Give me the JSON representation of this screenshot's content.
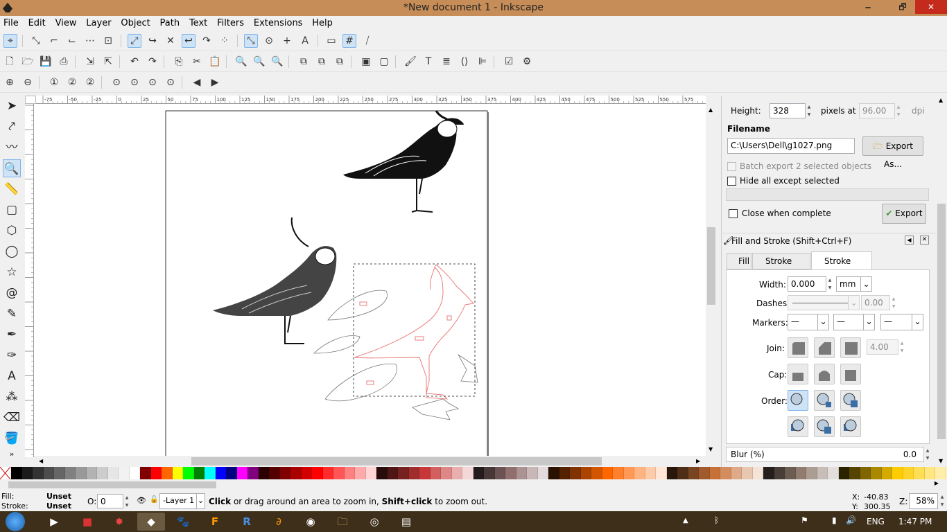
{
  "window": {
    "title": "*New document 1 - Inkscape",
    "minimize": "🗕",
    "restore": "🗗",
    "close": "✕"
  },
  "menu": [
    "File",
    "Edit",
    "View",
    "Layer",
    "Object",
    "Path",
    "Text",
    "Filters",
    "Extensions",
    "Help"
  ],
  "ruler": {
    "h_ticks": [
      "-75",
      "-50",
      "-25",
      "0",
      "25",
      "50",
      "75",
      "100",
      "125",
      "150",
      "175",
      "200",
      "225",
      "250",
      "275",
      "300",
      "325",
      "350",
      "375",
      "400",
      "425",
      "450",
      "475",
      "500",
      "525",
      "550",
      "575"
    ],
    "v_ticks": [
      "0",
      "2",
      "5",
      "0",
      "7",
      "5",
      "1",
      "0",
      "0",
      "1",
      "2",
      "5",
      "1",
      "5",
      "0",
      "1",
      "7",
      "5"
    ]
  },
  "export": {
    "height_label": "Height:",
    "height_value": "328",
    "pixels_at_label": "pixels at",
    "dpi_value": "96.00",
    "dpi_label": "dpi",
    "filename_heading": "Filename",
    "filename_value": "C:\\Users\\Dell\\g1027.png",
    "export_as_label": "Export As...",
    "batch_label": "Batch export 2 selected objects",
    "hide_label": "Hide all except selected",
    "close_label": "Close when complete",
    "export_label": "Export"
  },
  "fill_stroke": {
    "title": "Fill and Stroke (Shift+Ctrl+F)",
    "tabs": [
      "Fill",
      "Stroke paint",
      "Stroke style"
    ],
    "width_label": "Width:",
    "width_value": "0.000",
    "width_unit": "mm",
    "dashes_label": "Dashes:",
    "dashes_offset": "0.00",
    "markers_label": "Markers:",
    "marker_value": "—",
    "join_label": "Join:",
    "miter_value": "4.00",
    "cap_label": "Cap:",
    "order_label": "Order:",
    "blur_label": "Blur (%)",
    "blur_value": "0.0"
  },
  "palette_colors": [
    "#000000",
    "#1a1a1a",
    "#333333",
    "#4d4d4d",
    "#666666",
    "#808080",
    "#999999",
    "#b3b3b3",
    "#cccccc",
    "#e6e6e6",
    "#f2f2f2",
    "#ffffff",
    "#800000",
    "#ff0000",
    "#ff6600",
    "#ffff00",
    "#00ff00",
    "#008000",
    "#00ffff",
    "#0000ff",
    "#000080",
    "#ff00ff",
    "#800080",
    "#2b0000",
    "#550000",
    "#800000",
    "#aa0000",
    "#d40000",
    "#ff0000",
    "#ff2a2a",
    "#ff5555",
    "#ff8080",
    "#ffaaaa",
    "#ffd5d5",
    "#280b0b",
    "#501616",
    "#782121",
    "#a02c2c",
    "#c83737",
    "#d35f5f",
    "#de8787",
    "#e9afaf",
    "#f4d7d7",
    "#241c1c",
    "#483737",
    "#6c5353",
    "#916f6f",
    "#ac9393",
    "#c8b7b7",
    "#e3dbdb",
    "#2b1100",
    "#552200",
    "#803300",
    "#aa4400",
    "#d45500",
    "#ff6600",
    "#ff7f2a",
    "#ff9955",
    "#ffb380",
    "#ffccaa",
    "#ffe6d5",
    "#28170b",
    "#502d16",
    "#784421",
    "#a05a2c",
    "#c87137",
    "#d38d5f",
    "#deaa87",
    "#e9c6af",
    "#f4e3d7",
    "#241f1c",
    "#483e37",
    "#6c5d53",
    "#917c6f",
    "#ac9d93",
    "#c8beb7",
    "#e3dedb",
    "#2b2200",
    "#554400",
    "#806600",
    "#aa8800",
    "#d4aa00",
    "#ffcc00",
    "#ffd42a",
    "#ffdd55",
    "#ffe680",
    "#ffeeaa",
    "#fff6d5",
    "#28220b",
    "#504416",
    "#786721",
    "#a0892c",
    "#c8ab37"
  ],
  "status": {
    "fill_label": "Fill:",
    "fill_value": "Unset",
    "stroke_label": "Stroke:",
    "stroke_value": "Unset",
    "opacity_label": "O:",
    "opacity_value": "0",
    "layer_value": "-Layer 1",
    "message_parts": [
      "Click",
      " or drag around an area to zoom in, ",
      "Shift+click",
      " to zoom out."
    ],
    "x_label": "X:",
    "x_value": "-40.83",
    "y_label": "Y:",
    "y_value": "300.35",
    "z_label": "Z:",
    "zoom_value": "58%"
  },
  "taskbar": {
    "lang": "ENG",
    "time": "1:47 PM"
  }
}
